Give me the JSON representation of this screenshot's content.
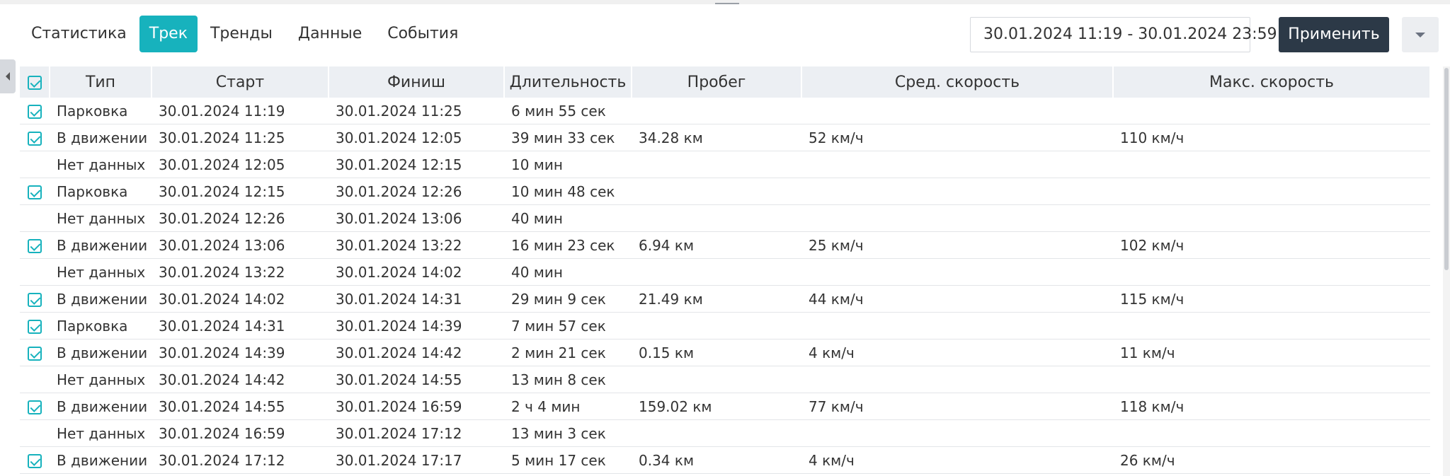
{
  "tabs": [
    {
      "label": "Статистика",
      "active": false
    },
    {
      "label": "Трек",
      "active": true
    },
    {
      "label": "Тренды",
      "active": false
    },
    {
      "label": "Данные",
      "active": false
    },
    {
      "label": "События",
      "active": false
    }
  ],
  "date_range": "30.01.2024 11:19 - 30.01.2024 23:59",
  "apply_label": "Применить",
  "colors": {
    "accent": "#17b2bd",
    "apply_bg": "#2c3947"
  },
  "table": {
    "columns": [
      "Тип",
      "Старт",
      "Финиш",
      "Длительность",
      "Пробег",
      "Сред. скорость",
      "Макс. скорость"
    ],
    "rows": [
      {
        "checked": true,
        "type": "Парковка",
        "start": "30.01.2024 11:19",
        "finish": "30.01.2024 11:25",
        "duration": "6 мин 55 сек",
        "distance": "",
        "avg_speed": "",
        "max_speed": ""
      },
      {
        "checked": true,
        "type": "В движении",
        "start": "30.01.2024 11:25",
        "finish": "30.01.2024 12:05",
        "duration": "39 мин 33 сек",
        "distance": "34.28 км",
        "avg_speed": "52 км/ч",
        "max_speed": "110 км/ч"
      },
      {
        "checked": false,
        "type": "Нет данных",
        "start": "30.01.2024 12:05",
        "finish": "30.01.2024 12:15",
        "duration": "10 мин",
        "distance": "",
        "avg_speed": "",
        "max_speed": ""
      },
      {
        "checked": true,
        "type": "Парковка",
        "start": "30.01.2024 12:15",
        "finish": "30.01.2024 12:26",
        "duration": "10 мин 48 сек",
        "distance": "",
        "avg_speed": "",
        "max_speed": ""
      },
      {
        "checked": false,
        "type": "Нет данных",
        "start": "30.01.2024 12:26",
        "finish": "30.01.2024 13:06",
        "duration": "40 мин",
        "distance": "",
        "avg_speed": "",
        "max_speed": ""
      },
      {
        "checked": true,
        "type": "В движении",
        "start": "30.01.2024 13:06",
        "finish": "30.01.2024 13:22",
        "duration": "16 мин 23 сек",
        "distance": "6.94 км",
        "avg_speed": "25 км/ч",
        "max_speed": "102 км/ч"
      },
      {
        "checked": false,
        "type": "Нет данных",
        "start": "30.01.2024 13:22",
        "finish": "30.01.2024 14:02",
        "duration": "40 мин",
        "distance": "",
        "avg_speed": "",
        "max_speed": ""
      },
      {
        "checked": true,
        "type": "В движении",
        "start": "30.01.2024 14:02",
        "finish": "30.01.2024 14:31",
        "duration": "29 мин 9 сек",
        "distance": "21.49 км",
        "avg_speed": "44 км/ч",
        "max_speed": "115 км/ч"
      },
      {
        "checked": true,
        "type": "Парковка",
        "start": "30.01.2024 14:31",
        "finish": "30.01.2024 14:39",
        "duration": "7 мин 57 сек",
        "distance": "",
        "avg_speed": "",
        "max_speed": ""
      },
      {
        "checked": true,
        "type": "В движении",
        "start": "30.01.2024 14:39",
        "finish": "30.01.2024 14:42",
        "duration": "2 мин 21 сек",
        "distance": "0.15 км",
        "avg_speed": "4 км/ч",
        "max_speed": "11 км/ч"
      },
      {
        "checked": false,
        "type": "Нет данных",
        "start": "30.01.2024 14:42",
        "finish": "30.01.2024 14:55",
        "duration": "13 мин 8 сек",
        "distance": "",
        "avg_speed": "",
        "max_speed": ""
      },
      {
        "checked": true,
        "type": "В движении",
        "start": "30.01.2024 14:55",
        "finish": "30.01.2024 16:59",
        "duration": "2 ч 4 мин",
        "distance": "159.02 км",
        "avg_speed": "77 км/ч",
        "max_speed": "118 км/ч"
      },
      {
        "checked": false,
        "type": "Нет данных",
        "start": "30.01.2024 16:59",
        "finish": "30.01.2024 17:12",
        "duration": "13 мин 3 сек",
        "distance": "",
        "avg_speed": "",
        "max_speed": ""
      },
      {
        "checked": true,
        "type": "В движении",
        "start": "30.01.2024 17:12",
        "finish": "30.01.2024 17:17",
        "duration": "5 мин 17 сек",
        "distance": "0.34 км",
        "avg_speed": "4 км/ч",
        "max_speed": "26 км/ч"
      }
    ]
  }
}
